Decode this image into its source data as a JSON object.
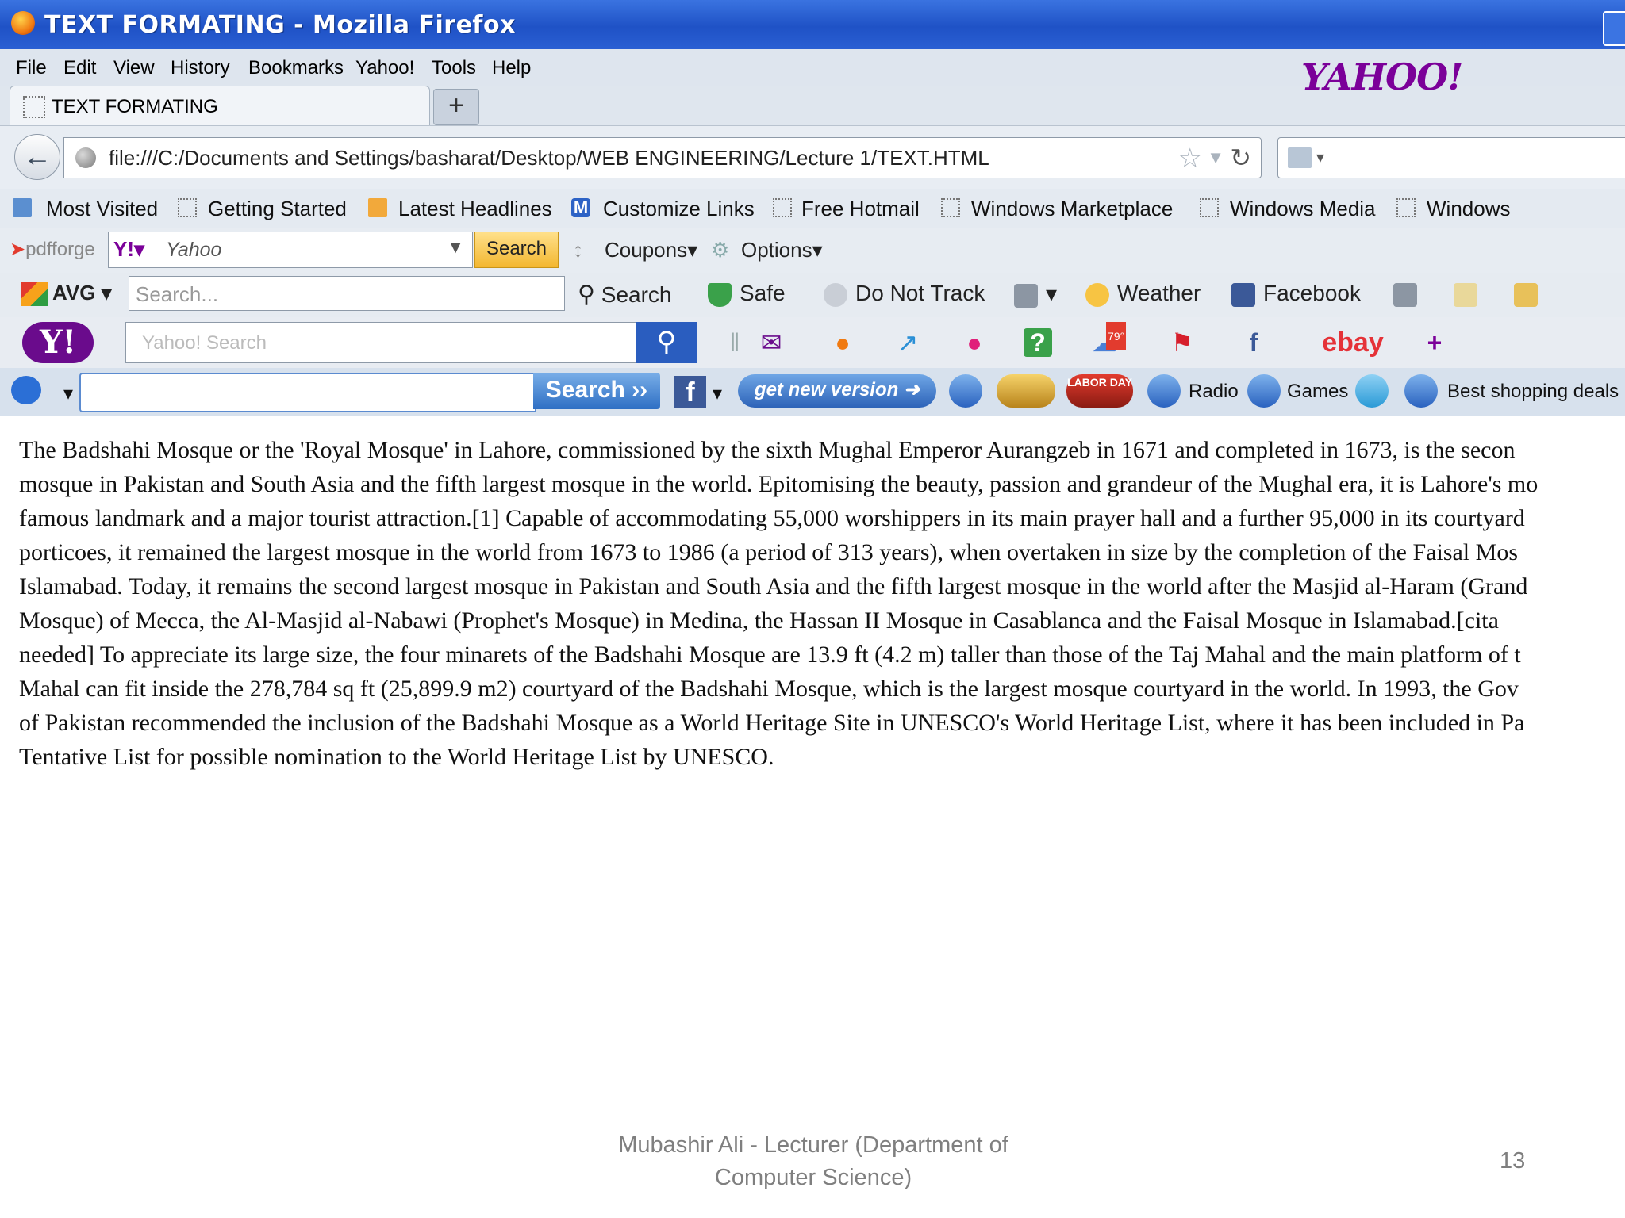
{
  "window": {
    "title": "TEXT FORMATING - Mozilla Firefox"
  },
  "menu": [
    "File",
    "Edit",
    "View",
    "History",
    "Bookmarks",
    "Yahoo!",
    "Tools",
    "Help"
  ],
  "yahoo_logo": "YAHOO!",
  "tab": {
    "label": "TEXT FORMATING",
    "new_tab": "+"
  },
  "nav": {
    "url": "file:///C:/Documents and Settings/basharat/Desktop/WEB ENGINEERING/Lecture 1/TEXT.HTML"
  },
  "bookmarks": [
    "Most Visited",
    "Getting Started",
    "Latest Headlines",
    "Customize Links",
    "Free Hotmail",
    "Windows Marketplace",
    "Windows Media",
    "Windows"
  ],
  "pdfforge": {
    "logo_a": "pdf",
    "logo_b": "forge",
    "engine": "Yahoo",
    "search_button": "Search",
    "coupons": "Coupons",
    "options": "Options"
  },
  "avg": {
    "logo": "AVG",
    "placeholder": "Search...",
    "search": "Search",
    "safe": "Safe",
    "do_not_track": "Do Not Track",
    "weather": "Weather",
    "facebook": "Facebook"
  },
  "yahoo_toolbar": {
    "placeholder": "Yahoo! Search",
    "weather_badge": "79°",
    "ebay": "ebay",
    "add": "+"
  },
  "last_toolbar": {
    "search_button": "Search ››",
    "get_new_version": "get new version",
    "labor_day": "LABOR DAY",
    "radio": "Radio",
    "games": "Games",
    "shopping": "Best shopping deals"
  },
  "content_lines": [
    "The Badshahi Mosque or the 'Royal Mosque' in Lahore, commissioned by the sixth Mughal Emperor Aurangzeb in 1671 and completed in 1673, is the secon",
    "mosque in Pakistan and South Asia and the fifth largest mosque in the world. Epitomising the beauty, passion and grandeur of the Mughal era, it is Lahore's mo",
    "famous landmark and a major tourist attraction.[1] Capable of accommodating 55,000 worshippers in its main prayer hall and a further 95,000 in its courtyard",
    "porticoes, it remained the largest mosque in the world from 1673 to 1986 (a period of 313 years), when overtaken in size by the completion of the Faisal Mos",
    "Islamabad. Today, it remains the second largest mosque in Pakistan and South Asia and the fifth largest mosque in the world after the Masjid al-Haram (Grand",
    "Mosque) of Mecca, the Al-Masjid al-Nabawi (Prophet's Mosque) in Medina, the Hassan II Mosque in Casablanca and the Faisal Mosque in Islamabad.[cita",
    "needed] To appreciate its large size, the four minarets of the Badshahi Mosque are 13.9 ft (4.2 m) taller than those of the Taj Mahal and the main platform of t",
    "Mahal can fit inside the 278,784 sq ft (25,899.9 m2) courtyard of the Badshahi Mosque, which is the largest mosque courtyard in the world. In 1993, the Gov",
    "of Pakistan recommended the inclusion of the Badshahi Mosque as a World Heritage Site in UNESCO's World Heritage List, where it has been included in Pa",
    "Tentative List for possible nomination to the World Heritage List by UNESCO."
  ],
  "footer": {
    "author_line1": "Mubashir Ali - Lecturer (Department of",
    "author_line2": "Computer Science)",
    "page": "13"
  }
}
